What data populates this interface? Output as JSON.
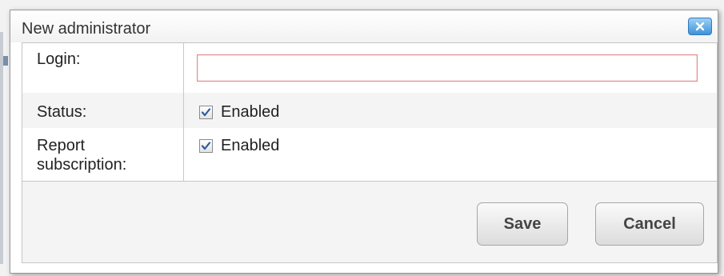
{
  "dialog": {
    "title": "New administrator",
    "close_icon": "close-icon"
  },
  "form": {
    "login_label": "Login:",
    "login_value": "",
    "status_label": "Status:",
    "status_checkbox_label": "Enabled",
    "status_checked": true,
    "report_label_line1": "Report",
    "report_label_line2": "subscription:",
    "report_checkbox_label": "Enabled",
    "report_checked": true
  },
  "footer": {
    "save_label": "Save",
    "cancel_label": "Cancel"
  },
  "colors": {
    "close_button": "#3d92d8",
    "input_error_border": "#e08a8a"
  }
}
